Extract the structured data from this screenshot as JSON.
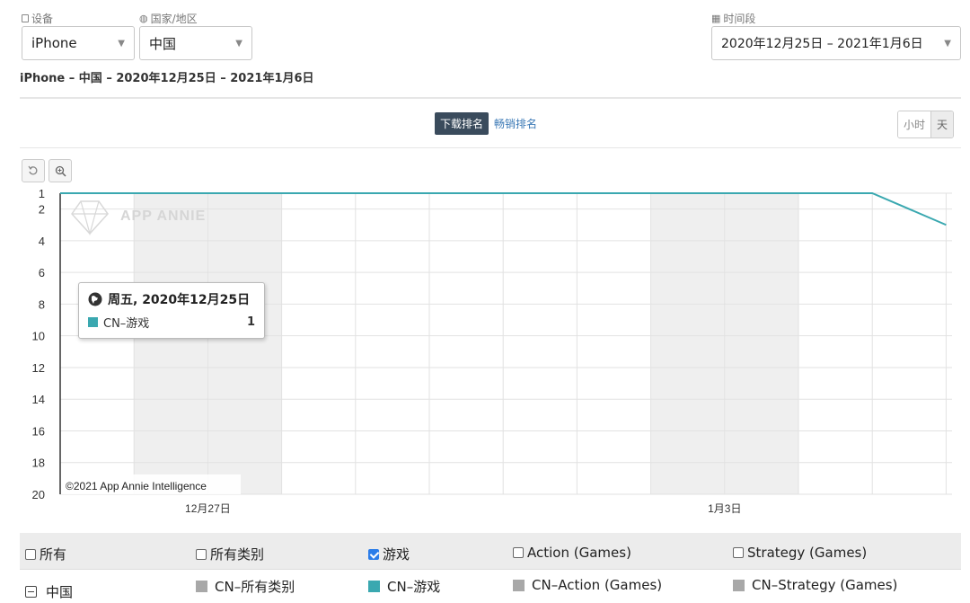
{
  "filters": {
    "device": {
      "label": "设备",
      "value": "iPhone"
    },
    "country": {
      "label": "国家/地区",
      "value": "中国"
    },
    "period": {
      "label": "时间段",
      "value": "2020年12月25日 – 2021年1月6日"
    }
  },
  "subtitle": "iPhone – 中国 – 2020年12月25日 – 2021年1月6日",
  "tabs": {
    "download": "下载排名",
    "revenue": "畅销排名"
  },
  "granularity": {
    "hour": "小时",
    "day": "天"
  },
  "chart_data": {
    "type": "line",
    "x": [
      "2020-12-25",
      "2020-12-26",
      "2020-12-27",
      "2020-12-28",
      "2020-12-29",
      "2020-12-30",
      "2020-12-31",
      "2021-01-01",
      "2021-01-02",
      "2021-01-03",
      "2021-01-04",
      "2021-01-05",
      "2021-01-06"
    ],
    "x_tick_labels": [
      {
        "date": "2020-12-27",
        "text": "12月27日"
      },
      {
        "date": "2021-01-03",
        "text": "1月3日"
      }
    ],
    "yticks": [
      1,
      2,
      4,
      6,
      8,
      10,
      12,
      14,
      16,
      18,
      20
    ],
    "ylim": [
      1,
      20
    ],
    "y_reversed": true,
    "weekend_bands": [
      [
        "2020-12-26",
        "2020-12-28"
      ],
      [
        "2021-01-02",
        "2021-01-04"
      ]
    ],
    "series": [
      {
        "name": "CN–游戏",
        "color": "#3aa8b0",
        "values": [
          1,
          1,
          1,
          1,
          1,
          1,
          1,
          1,
          1,
          1,
          1,
          1,
          3
        ]
      }
    ],
    "watermark": "APP ANNIE",
    "copyright": "©2021 App Annie Intelligence",
    "grid": true
  },
  "tooltip": {
    "date": "周五, 2020年12月25日",
    "series": "CN–游戏",
    "value": "1"
  },
  "legend": {
    "checks": [
      {
        "label": "所有",
        "checked": false
      },
      {
        "label": "所有类别",
        "checked": false
      },
      {
        "label": "游戏",
        "checked": true
      },
      {
        "label": "Action (Games)",
        "checked": false
      },
      {
        "label": "Strategy (Games)",
        "checked": false
      }
    ],
    "group": "中国",
    "series": [
      {
        "label": "CN–所有类别",
        "color": "#a8a8a8"
      },
      {
        "label": "CN–游戏",
        "color": "#3aa8b0"
      },
      {
        "label": "CN–Action (Games)",
        "color": "#a8a8a8"
      },
      {
        "label": "CN–Strategy (Games)",
        "color": "#a8a8a8"
      }
    ]
  }
}
